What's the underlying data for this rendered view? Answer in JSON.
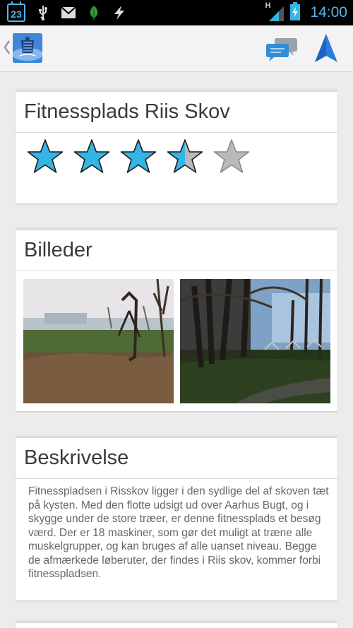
{
  "status_bar": {
    "calendar_day": "23",
    "network": "H",
    "time": "14:00",
    "accent": "#4fb7e8",
    "icons": [
      "calendar-icon",
      "usb-icon",
      "mail-icon",
      "leaf-icon",
      "lightning-icon",
      "signal-icon",
      "battery-icon"
    ]
  },
  "action_bar": {
    "icons": [
      "back-caret-icon",
      "app-logo-icon",
      "chat-icon",
      "navigation-arrow-icon"
    ]
  },
  "rating_card": {
    "title": "Fitnessplads Riis Skov",
    "rating": 3.5,
    "max_rating": 5,
    "star_color": "#33b5e5",
    "empty_star_color": "#b9b9b9"
  },
  "images_card": {
    "title": "Billeder",
    "photos": [
      "park-photo-fitness-equipment",
      "park-photo-forest-path"
    ]
  },
  "description_card": {
    "title": "Beskrivelse",
    "text": "Fitnesspladsen i Risskov ligger i den sydlige del af skoven tæt på kysten. Med den flotte udsigt ud over Aarhus Bugt, og i skygge under de store træer, er denne fitnessplads et besøg værd. Der er 18 maskiner, som gør det muligt at træne alle muskelgrupper, og kan bruges af alle uanset niveau. Begge de afmærkede løberuter, der findes i Riis skov, kommer forbi fitnesspladsen."
  }
}
